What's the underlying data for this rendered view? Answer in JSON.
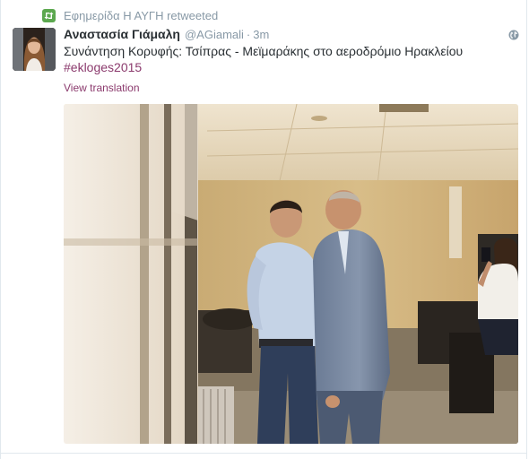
{
  "retweet": {
    "icon": "retweet-icon",
    "text": "Εφημερίδα Η ΑΥΓΗ retweeted"
  },
  "author": {
    "fullname": "Αναστασία Γιάμαλη",
    "username": "@AGiamali",
    "separator": "·",
    "time": "3m"
  },
  "tweet": {
    "text": "Συνάντηση Κορυφής: Τσίπρας - Μεϊμαράκης στο αεροδρόμιο Ηρακλείου",
    "hashtag": "#ekloges2015",
    "translate_label": "View translation"
  },
  "icons": {
    "globe": "globe-icon"
  },
  "colors": {
    "link": "#8b3a6d",
    "muted": "#8899a6",
    "text": "#292f33",
    "retweet_green": "#5ca84f"
  }
}
